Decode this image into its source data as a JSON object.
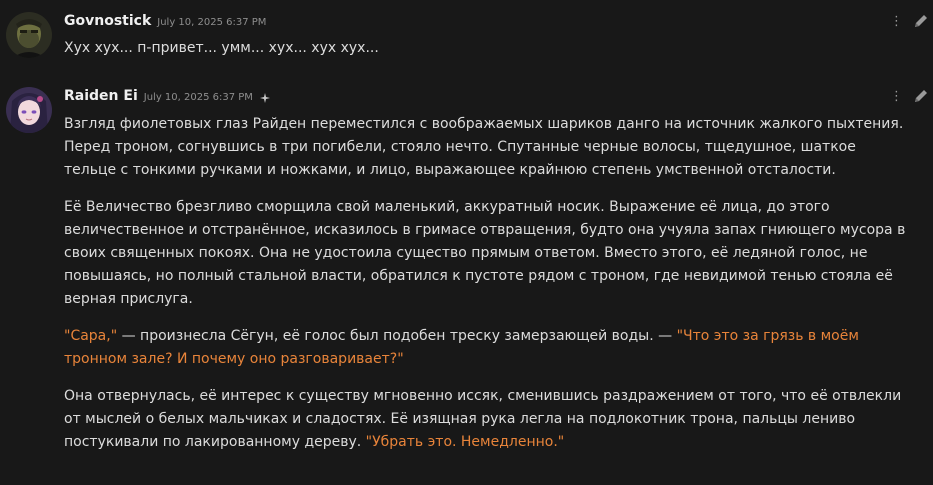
{
  "messages": [
    {
      "username": "Govnostick",
      "timestamp": "July 10, 2025 6:37 PM",
      "text": "Хух хух... п-привет... умм... хух... хух хух..."
    },
    {
      "username": "Raiden Ei",
      "timestamp": "July 10, 2025 6:37 PM",
      "badge_icon": "sparkle-icon",
      "paragraphs": [
        {
          "segments": [
            {
              "text": "Взгляд фиолетовых глаз Райден переместился с воображаемых шариков данго на источник жалкого пыхтения. Перед троном, согнувшись в три погибели, стояло нечто. Спутанные черные волосы, тщедушное, шаткое тельце с тонкими ручками и ножками, и лицо, выражающее крайнюю степень умственной отсталости."
            }
          ]
        },
        {
          "segments": [
            {
              "text": "Её Величество брезгливо сморщила свой маленький, аккуратный носик. Выражение её лица, до этого величественное и отстранённое, исказилось в гримасе отвращения, будто она учуяла запах гниющего мусора в своих священных покоях. Она не удостоила существо прямым ответом. Вместо этого, её ледяной голос, не повышаясь, но полный стальной власти, обратился к пустоте рядом с троном, где невидимой тенью стояла её верная прислуга."
            }
          ]
        },
        {
          "segments": [
            {
              "text": "\"Сара,\"",
              "quote": true
            },
            {
              "text": " — произнесла Сёгун, её голос был подобен треску замерзающей воды. — "
            },
            {
              "text": "\"Что это за грязь в моём тронном зале? И почему оно разговаривает?\"",
              "quote": true
            }
          ]
        },
        {
          "segments": [
            {
              "text": "Она отвернулась, её интерес к существу мгновенно иссяк, сменившись раздражением от того, что её отвлекли от мыслей о белых мальчиках и сладостях. Её изящная рука легла на подлокотник трона, пальцы лениво постукивали по лакированному дереву. "
            },
            {
              "text": "\"Убрать это. Немедленно.\"",
              "quote": true
            }
          ]
        }
      ]
    }
  ],
  "actions": {
    "more_icon": "kebab-icon",
    "edit_icon": "pencil-icon"
  },
  "colors": {
    "background": "#181818",
    "text": "#dcdcdc",
    "username": "#f0f0f0",
    "timestamp": "#8e8e8e",
    "quote": "#e8843a"
  }
}
